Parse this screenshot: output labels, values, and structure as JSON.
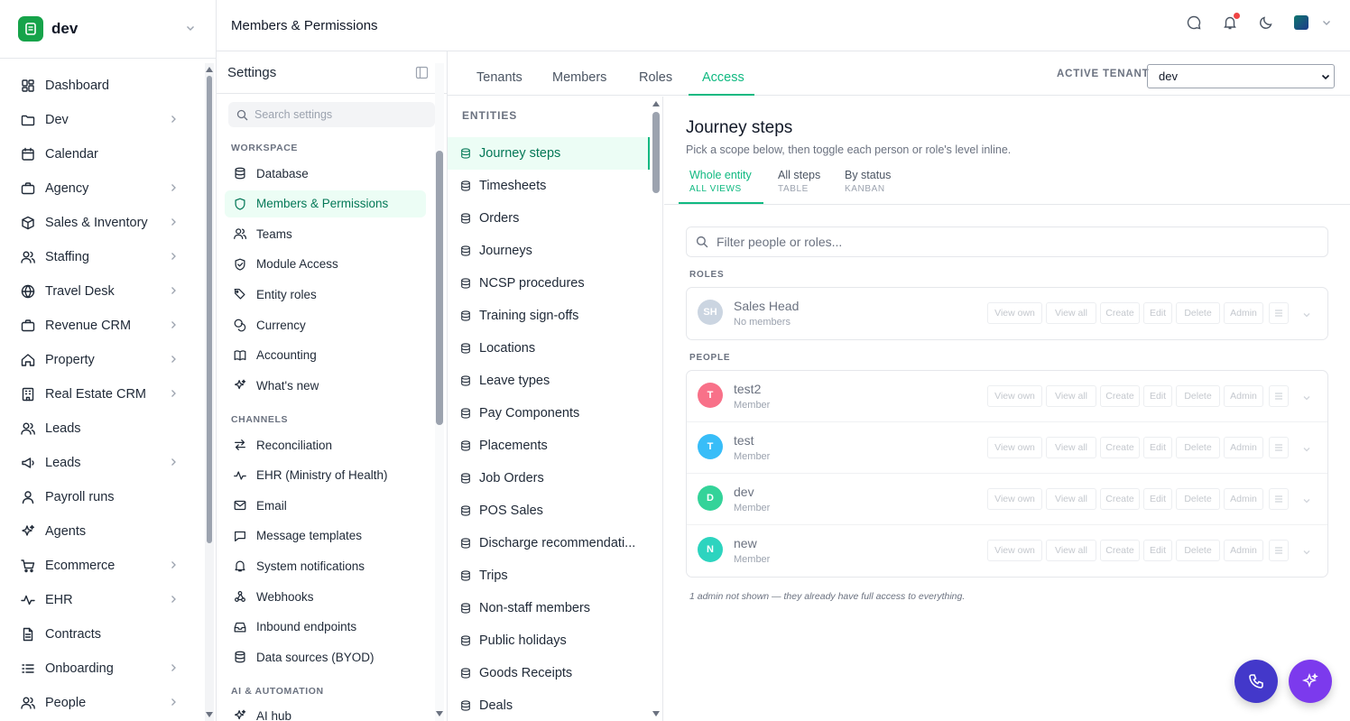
{
  "workspace": {
    "name": "dev"
  },
  "nav": [
    {
      "label": "Dashboard",
      "icon": "dashboard-icon",
      "chev": false
    },
    {
      "label": "Dev",
      "icon": "folder-icon",
      "chev": true
    },
    {
      "label": "Calendar",
      "icon": "calendar-icon",
      "chev": false
    },
    {
      "label": "Agency",
      "icon": "briefcase-icon",
      "chev": true
    },
    {
      "label": "Sales & Inventory",
      "icon": "box-icon",
      "chev": true
    },
    {
      "label": "Staffing",
      "icon": "users-icon",
      "chev": true
    },
    {
      "label": "Travel Desk",
      "icon": "globe-icon",
      "chev": true
    },
    {
      "label": "Revenue CRM",
      "icon": "briefcase-icon",
      "chev": true
    },
    {
      "label": "Property",
      "icon": "home-icon",
      "chev": true
    },
    {
      "label": "Real Estate CRM",
      "icon": "building-icon",
      "chev": true
    },
    {
      "label": "Leads",
      "icon": "users-icon",
      "chev": false
    },
    {
      "label": "Leads",
      "icon": "megaphone-icon",
      "chev": true
    },
    {
      "label": "Payroll runs",
      "icon": "user-icon",
      "chev": false
    },
    {
      "label": "Agents",
      "icon": "sparkles-icon",
      "chev": false
    },
    {
      "label": "Ecommerce",
      "icon": "cart-icon",
      "chev": true
    },
    {
      "label": "EHR",
      "icon": "activity-icon",
      "chev": true
    },
    {
      "label": "Contracts",
      "icon": "document-icon",
      "chev": false
    },
    {
      "label": "Onboarding",
      "icon": "list-icon",
      "chev": true
    },
    {
      "label": "People",
      "icon": "users-icon",
      "chev": true
    }
  ],
  "header": {
    "title": "Members & Permissions"
  },
  "settings": {
    "title": "Settings",
    "search_placeholder": "Search settings",
    "workspace_label": "WORKSPACE",
    "channels_label": "CHANNELS",
    "ai_label": "AI & AUTOMATION",
    "workspace_items": [
      {
        "label": "Database",
        "icon": "database-icon",
        "active": false
      },
      {
        "label": "Members & Permissions",
        "icon": "shield-icon",
        "active": true
      },
      {
        "label": "Teams",
        "icon": "users-icon",
        "active": false
      },
      {
        "label": "Module Access",
        "icon": "shield-check-icon",
        "active": false
      },
      {
        "label": "Entity roles",
        "icon": "tags-icon",
        "active": false
      },
      {
        "label": "Currency",
        "icon": "coins-icon",
        "active": false
      },
      {
        "label": "Accounting",
        "icon": "book-icon",
        "active": false
      },
      {
        "label": "What's new",
        "icon": "sparkles-icon",
        "active": false
      }
    ],
    "channel_items": [
      {
        "label": "Reconciliation",
        "icon": "arrows-icon"
      },
      {
        "label": "EHR (Ministry of Health)",
        "icon": "activity-icon"
      },
      {
        "label": "Email",
        "icon": "mail-icon"
      },
      {
        "label": "Message templates",
        "icon": "message-icon"
      },
      {
        "label": "System notifications",
        "icon": "bell-icon"
      },
      {
        "label": "Webhooks",
        "icon": "webhook-icon"
      },
      {
        "label": "Inbound endpoints",
        "icon": "inbox-icon"
      },
      {
        "label": "Data sources (BYOD)",
        "icon": "database-icon"
      }
    ],
    "ai_items": [
      {
        "label": "AI hub",
        "icon": "sparkles-icon"
      }
    ]
  },
  "tabs": [
    "Tenants",
    "Members",
    "Roles",
    "Access"
  ],
  "active_tab": "Access",
  "tenant": {
    "label": "ACTIVE TENANT",
    "value": "dev"
  },
  "entities": {
    "heading": "ENTITIES",
    "items": [
      "Journey steps",
      "Timesheets",
      "Orders",
      "Journeys",
      "NCSP procedures",
      "Training sign-offs",
      "Locations",
      "Leave types",
      "Pay Components",
      "Placements",
      "Job Orders",
      "POS Sales",
      "Discharge recommendati...",
      "Trips",
      "Non-staff members",
      "Public holidays",
      "Goods Receipts",
      "Deals"
    ]
  },
  "detail": {
    "title": "Journey steps",
    "subtitle": "Pick a scope below, then toggle each person or role's level inline.",
    "views": [
      {
        "label": "Whole entity",
        "sub": "ALL VIEWS"
      },
      {
        "label": "All steps",
        "sub": "TABLE"
      },
      {
        "label": "By status",
        "sub": "KANBAN"
      }
    ],
    "filter_placeholder": "Filter people or roles...",
    "roles_label": "ROLES",
    "people_label": "PEOPLE",
    "perm_labels": [
      "View own",
      "View all",
      "Create",
      "Edit",
      "Delete",
      "Admin"
    ],
    "roles": [
      {
        "initials": "SH",
        "name": "Sales Head",
        "sub": "No members",
        "color": "#cbd5e1"
      }
    ],
    "people": [
      {
        "initials": "T",
        "name": "test2",
        "sub": "Member",
        "color": "#f87189"
      },
      {
        "initials": "T",
        "name": "test",
        "sub": "Member",
        "color": "#38bdf8"
      },
      {
        "initials": "D",
        "name": "dev",
        "sub": "Member",
        "color": "#34d399"
      },
      {
        "initials": "N",
        "name": "new",
        "sub": "Member",
        "color": "#2dd4bf"
      }
    ],
    "note": "1 admin not shown — they already have full access to everything."
  },
  "colors": {
    "accent": "#10b981",
    "fab_call": "#4338ca",
    "fab_ai": "#7c3aed"
  }
}
